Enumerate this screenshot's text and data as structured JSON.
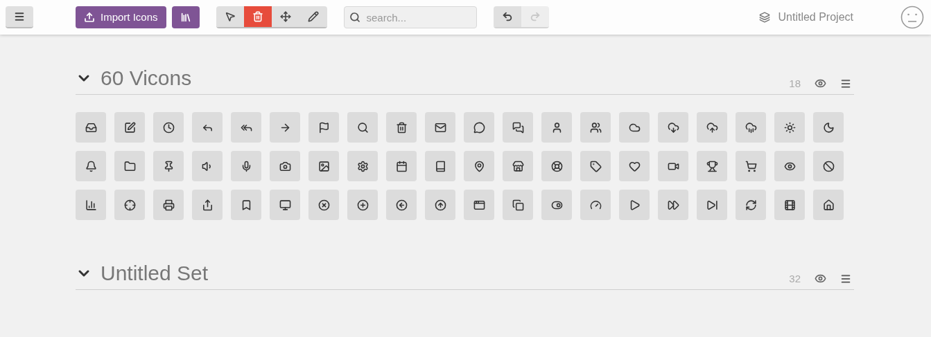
{
  "toolbar": {
    "import_button": "Import Icons",
    "modes": [
      {
        "kind": "select",
        "selected": false
      },
      {
        "kind": "delete",
        "selected": true
      },
      {
        "kind": "move",
        "selected": false
      },
      {
        "kind": "edit",
        "selected": false
      }
    ],
    "search": {
      "placeholder": "search..."
    },
    "history": [
      {
        "kind": "undo",
        "disabled": false
      },
      {
        "kind": "redo",
        "disabled": true
      }
    ],
    "project": "Untitled Project"
  },
  "sets": [
    {
      "title": "60 Vicons",
      "expanded": true,
      "count": "18",
      "icons": [
        {
          "kind": "inbox"
        },
        {
          "kind": "edit"
        },
        {
          "kind": "clock"
        },
        {
          "kind": "reply"
        },
        {
          "kind": "reply-all"
        },
        {
          "kind": "arrow"
        },
        {
          "kind": "flag"
        },
        {
          "kind": "search"
        },
        {
          "kind": "trash"
        },
        {
          "kind": "mail"
        },
        {
          "kind": "chat"
        },
        {
          "kind": "chats"
        },
        {
          "kind": "user"
        },
        {
          "kind": "users"
        },
        {
          "kind": "cloud"
        },
        {
          "kind": "cloud-download"
        },
        {
          "kind": "cloud-upload"
        },
        {
          "kind": "rain"
        },
        {
          "kind": "sun"
        },
        {
          "kind": "moon"
        },
        {
          "kind": "bell"
        },
        {
          "kind": "folder"
        },
        {
          "kind": "pin"
        },
        {
          "kind": "volume"
        },
        {
          "kind": "mic"
        },
        {
          "kind": "camera"
        },
        {
          "kind": "image"
        },
        {
          "kind": "gear"
        },
        {
          "kind": "calendar"
        },
        {
          "kind": "book"
        },
        {
          "kind": "location"
        },
        {
          "kind": "store"
        },
        {
          "kind": "lifebuoy"
        },
        {
          "kind": "tag"
        },
        {
          "kind": "heart"
        },
        {
          "kind": "video"
        },
        {
          "kind": "trophy"
        },
        {
          "kind": "cart"
        },
        {
          "kind": "eye"
        },
        {
          "kind": "ban"
        },
        {
          "kind": "chart"
        },
        {
          "kind": "crosshair"
        },
        {
          "kind": "printer"
        },
        {
          "kind": "share"
        },
        {
          "kind": "bookmark"
        },
        {
          "kind": "monitor"
        },
        {
          "kind": "circle-x"
        },
        {
          "kind": "circle-plus"
        },
        {
          "kind": "circle-left"
        },
        {
          "kind": "circle-up"
        },
        {
          "kind": "window"
        },
        {
          "kind": "copy"
        },
        {
          "kind": "toggle"
        },
        {
          "kind": "gauge"
        },
        {
          "kind": "play"
        },
        {
          "kind": "fast-forward"
        },
        {
          "kind": "skip"
        },
        {
          "kind": "refresh"
        },
        {
          "kind": "film"
        },
        {
          "kind": "home"
        }
      ]
    },
    {
      "title": "Untitled Set",
      "expanded": true,
      "count": "32"
    }
  ]
}
